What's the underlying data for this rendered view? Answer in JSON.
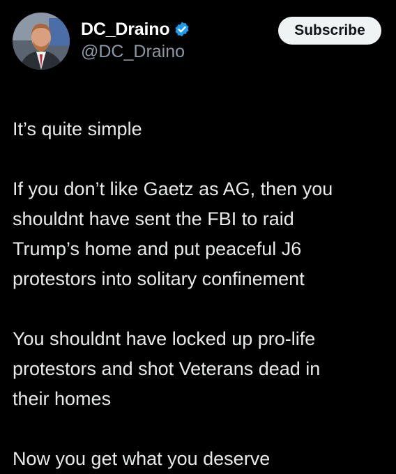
{
  "author": {
    "display_name": "DC_Draino",
    "handle": "@DC_Draino",
    "verified_icon": "verified-badge-icon",
    "verified_color": "#1d9bf0"
  },
  "subscribe": {
    "label": "Subscribe"
  },
  "post": {
    "paragraphs": [
      [
        "It’s quite simple"
      ],
      [
        "If you don’t like Gaetz as AG, then you",
        "shouldnt have sent the FBI to raid",
        "Trump’s home and put peaceful J6",
        "protestors into solitary confinement"
      ],
      [
        "You shouldnt have locked up pro-life",
        "protestors and shot Veterans dead in",
        "their homes"
      ],
      [
        "Now you get what you deserve"
      ]
    ]
  }
}
